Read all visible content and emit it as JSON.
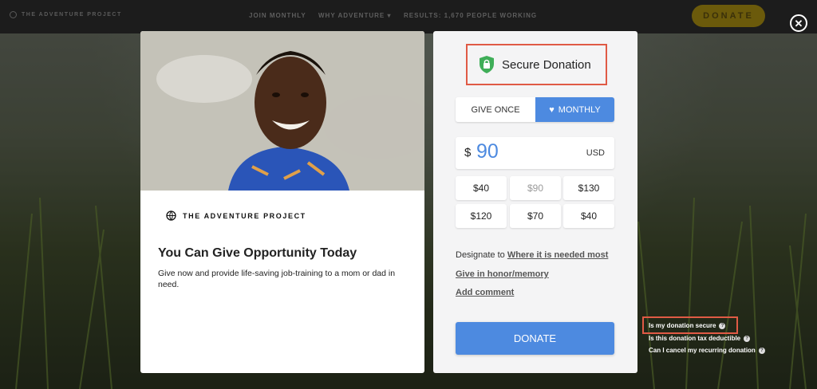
{
  "topbar": {
    "brand": "THE ADVENTURE PROJECT",
    "nav": [
      "JOIN MONTHLY",
      "WHY ADVENTURE ▾",
      "RESULTS: 1,670 PEOPLE WORKING"
    ],
    "donate_label": "DONATE",
    "close_symbol": "✕"
  },
  "left_card": {
    "logo_text": "THE ADVENTURE PROJECT",
    "title": "You Can Give Opportunity Today",
    "description": "Give now and provide life-saving job-training to a mom or dad in need."
  },
  "right_card": {
    "secure_label": "Secure Donation",
    "frequency": {
      "once": "GIVE ONCE",
      "monthly": "MONTHLY",
      "selected": "monthly"
    },
    "amount": {
      "currency_symbol": "$",
      "value": "90",
      "currency": "USD"
    },
    "presets": [
      "$40",
      "$90",
      "$130",
      "$120",
      "$70",
      "$40"
    ],
    "selected_preset_index": 1,
    "designate_prefix": "Designate to",
    "designate_link": "Where it is needed most",
    "honor_link": "Give in honor/memory",
    "comment_link": "Add comment",
    "donate_label": "DONATE"
  },
  "faq": [
    "Is my donation secure",
    "Is this donation tax deductible",
    "Can I cancel my recurring donation"
  ],
  "colors": {
    "accent": "#4d8ae0",
    "highlight": "#e05a45",
    "topbar": "#1c1c1c",
    "donate_top": "#6b5a0b"
  }
}
